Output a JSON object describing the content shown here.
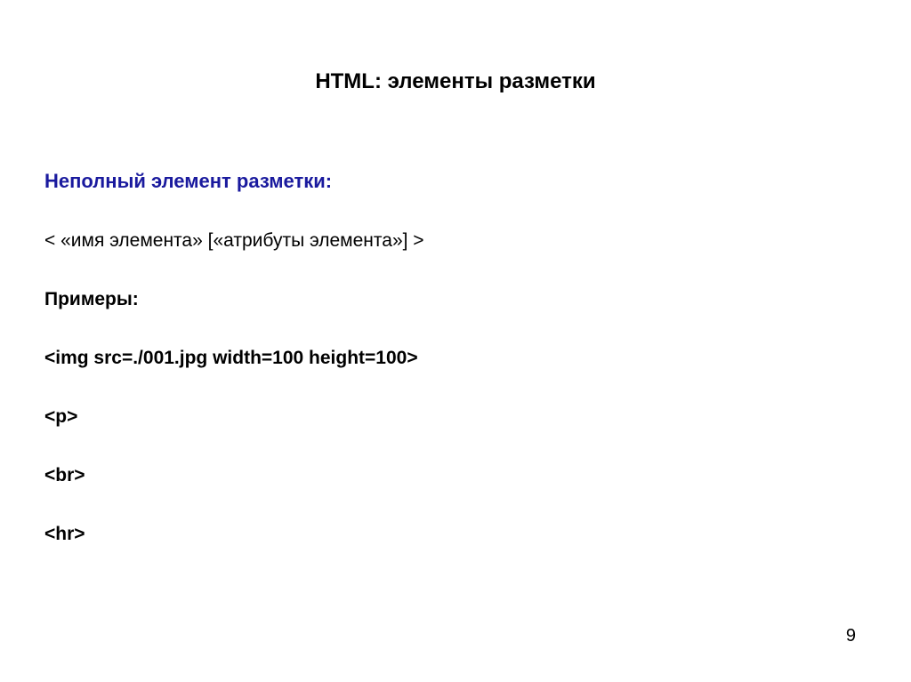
{
  "title": "HTML: элементы разметки",
  "subtitle": "Неполный элемент разметки:",
  "syntax": "< «имя элемента» [«атрибуты элемента»] >",
  "examplesLabel": "Примеры:",
  "examples": [
    "<img src=./001.jpg width=100 height=100>",
    "<p>",
    "<br>",
    "<hr>"
  ],
  "pageNumber": "9"
}
